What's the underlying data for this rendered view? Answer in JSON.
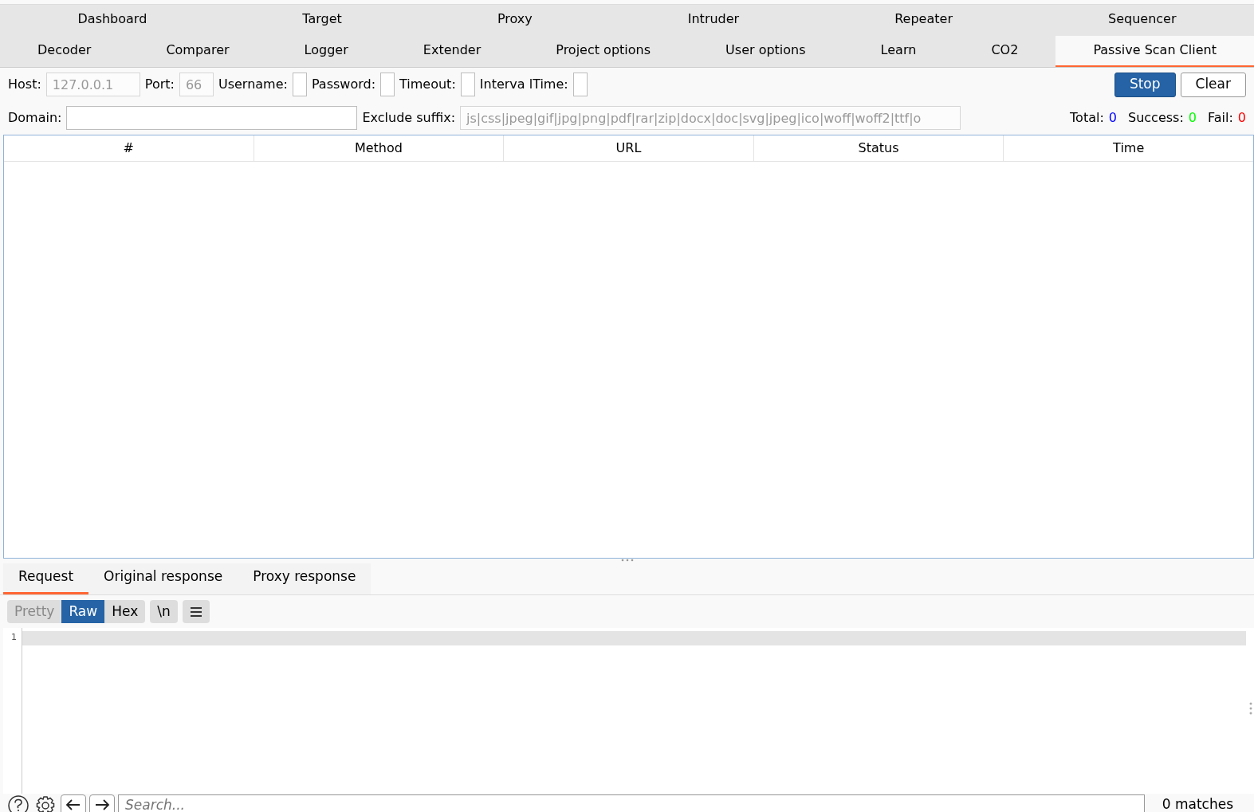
{
  "tabs_row_1": [
    {
      "label": "Dashboard",
      "selected": false
    },
    {
      "label": "Target",
      "selected": false
    },
    {
      "label": "Proxy",
      "selected": false
    },
    {
      "label": "Intruder",
      "selected": false
    },
    {
      "label": "Repeater",
      "selected": false
    },
    {
      "label": "Sequencer",
      "selected": false
    }
  ],
  "tabs_row_2": [
    {
      "label": "Decoder",
      "selected": false
    },
    {
      "label": "Comparer",
      "selected": false
    },
    {
      "label": "Logger",
      "selected": false
    },
    {
      "label": "Extender",
      "selected": false
    },
    {
      "label": "Project options",
      "selected": false
    },
    {
      "label": "User options",
      "selected": false
    },
    {
      "label": "Learn",
      "selected": false
    },
    {
      "label": "CO2",
      "selected": false
    },
    {
      "label": "Passive Scan Client",
      "selected": true
    }
  ],
  "settings_row": [
    {
      "label": "Host:",
      "value": "127.0.0.1",
      "disabled": true
    },
    {
      "label": "Port:",
      "value": "66",
      "disabled": true
    },
    {
      "label": "Username:",
      "disabled": false
    },
    {
      "label": "Password:",
      "disabled": false
    },
    {
      "label": "Timeout:",
      "disabled": false
    },
    {
      "label": "Interva lTime:",
      "disabled": false
    }
  ],
  "action_buttons": [
    {
      "label": "Stop",
      "primary": true
    },
    {
      "label": "Clear",
      "primary": false
    }
  ],
  "filter_row": [
    {
      "label": "Domain:",
      "disabled": false
    },
    {
      "label": "Exclude suffix:",
      "value": "js|css|jpeg|gif|jpg|png|pdf|rar|zip|docx|doc|svg|jpeg|ico|woff|woff2|ttf|o",
      "disabled": true
    }
  ],
  "counters": [
    {
      "label": "Total:",
      "value": "0",
      "color": "#0000ff"
    },
    {
      "label": "Success:",
      "value": "0",
      "color": "#00ff00"
    },
    {
      "label": "Fail:",
      "value": "0",
      "color": "#ff0000"
    }
  ],
  "table": {
    "columns": [
      "#",
      "Method",
      "URL",
      "Status",
      "Time"
    ]
  },
  "message_tabs": [
    {
      "label": "Request",
      "selected": true
    },
    {
      "label": "Original response",
      "selected": false
    },
    {
      "label": "Proxy response",
      "selected": false
    }
  ],
  "view_modes": [
    {
      "label": "Pretty",
      "selected": false,
      "disabled": true
    },
    {
      "label": "Raw",
      "selected": true,
      "disabled": false
    },
    {
      "label": "Hex",
      "selected": false,
      "disabled": false
    }
  ],
  "newline_toggle": "\\n",
  "editor": {
    "line_numbers": [
      "1"
    ]
  },
  "search": {
    "placeholder": "Search...",
    "matches": "0 matches"
  }
}
